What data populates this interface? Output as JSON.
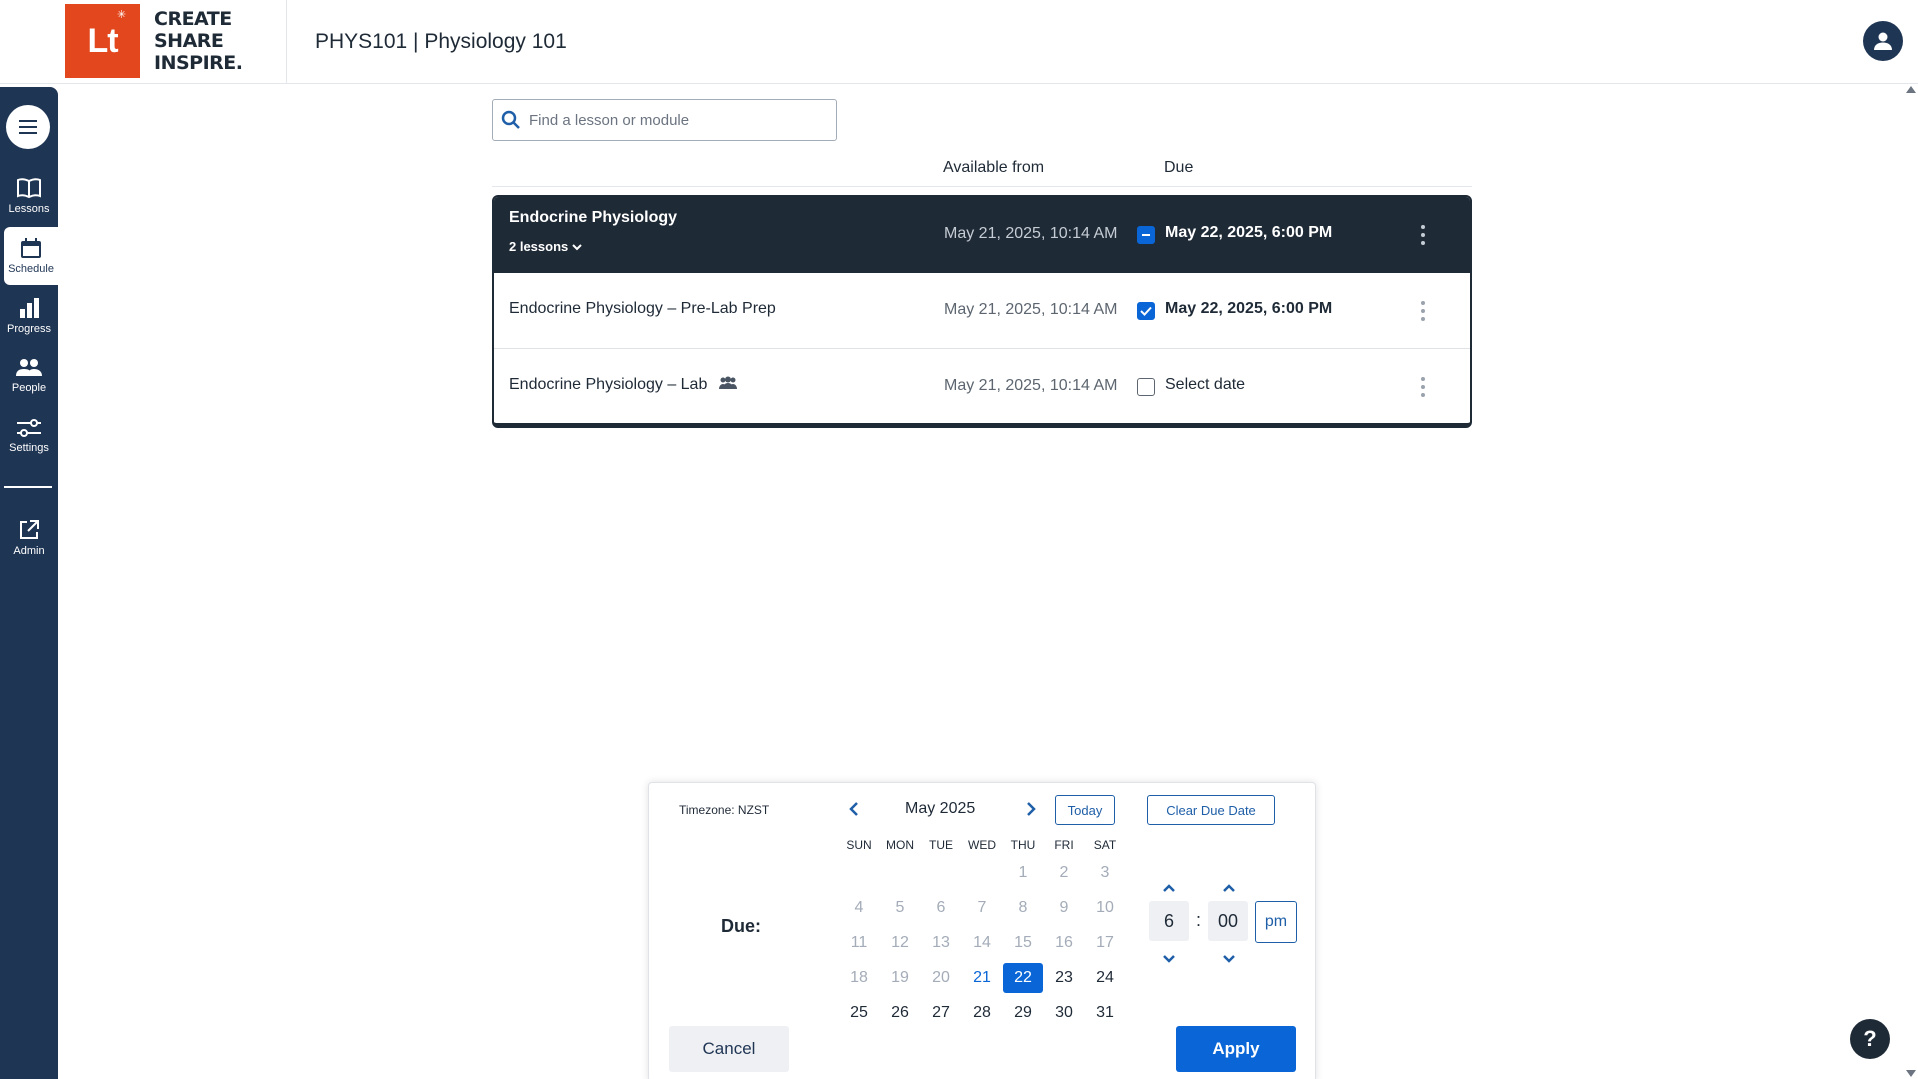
{
  "header": {
    "logo_text": "Lt",
    "logo_tagline": [
      "CREATE",
      "SHARE",
      "INSPIRE."
    ],
    "course_title": "PHYS101 | Physiology 101"
  },
  "sidebar": {
    "items": [
      {
        "label": "Lessons",
        "icon": "book-icon"
      },
      {
        "label": "Schedule",
        "icon": "calendar-icon",
        "active": true
      },
      {
        "label": "Progress",
        "icon": "bar-chart-icon"
      },
      {
        "label": "People",
        "icon": "people-icon"
      },
      {
        "label": "Settings",
        "icon": "sliders-icon"
      },
      {
        "label": "Admin",
        "icon": "external-link-icon"
      }
    ]
  },
  "search": {
    "placeholder": "Find a lesson or module",
    "value": ""
  },
  "table": {
    "columns": {
      "available": "Available from",
      "due": "Due"
    },
    "module": {
      "title": "Endocrine Physiology",
      "lessons_toggle": "2 lessons",
      "available": "May 21, 2025, 10:14 AM",
      "due": "May 22, 2025, 6:00 PM",
      "checkbox": "partial"
    },
    "lessons": [
      {
        "title": "Endocrine Physiology – Pre-Lab Prep",
        "available": "May 21, 2025, 10:14 AM",
        "due": "May 22, 2025, 6:00 PM",
        "checkbox": "checked"
      },
      {
        "title": "Endocrine Physiology – Lab",
        "available": "May 21, 2025, 10:14 AM",
        "due": "Select date",
        "checkbox": "unchecked",
        "group_icon": "group-icon"
      }
    ]
  },
  "picker": {
    "timezone": "Timezone: NZST",
    "due_label": "Due:",
    "month": "May 2025",
    "today_label": "Today",
    "clear_label": "Clear Due Date",
    "weekdays": [
      "SUN",
      "MON",
      "TUE",
      "WED",
      "THU",
      "FRI",
      "SAT"
    ],
    "weeks": [
      [
        "",
        "",
        "",
        "",
        "1",
        "2",
        "3"
      ],
      [
        "4",
        "5",
        "6",
        "7",
        "8",
        "9",
        "10"
      ],
      [
        "11",
        "12",
        "13",
        "14",
        "15",
        "16",
        "17"
      ],
      [
        "18",
        "19",
        "20",
        "21",
        "22",
        "23",
        "24"
      ],
      [
        "25",
        "26",
        "27",
        "28",
        "29",
        "30",
        "31"
      ]
    ],
    "today_day": "21",
    "selected_day": "22",
    "last_disabled_day": 20,
    "hour": "6",
    "minute": "00",
    "time_separator": ":",
    "ampm": "pm",
    "cancel_label": "Cancel",
    "apply_label": "Apply"
  },
  "help_label": "?",
  "colors": {
    "sidebar": "#1f3554",
    "module_row": "#1f2a37",
    "accent": "#0a66d6",
    "logo": "#e3471d"
  }
}
